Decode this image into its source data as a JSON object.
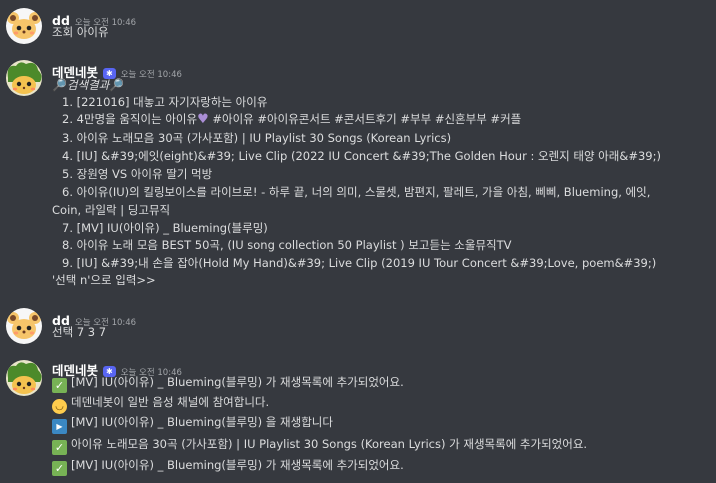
{
  "messages": [
    {
      "author": "dd",
      "timestamp": "오늘 오전 10:46",
      "is_bot": false,
      "lines": [
        "조회 아이유"
      ]
    },
    {
      "author": "데덴네봇",
      "timestamp": "오늘 오전 10:46",
      "is_bot": true,
      "bot_badge": "✱",
      "title_prefix": "🔎",
      "title": "검색결과",
      "title_suffix": "🔎",
      "results": [
        "1. [221016] 대놓고 자기자랑하는 아이유",
        "2. 4만명을 움직이는 아이유",
        "3. 아이유 노래모음 30곡 (가사포함) | IU Playlist 30 Songs (Korean Lyrics)",
        "4. [IU] &#39;에잇(eight)&#39; Live Clip (2022 IU Concert &#39;The Golden Hour : 오렌지 태양 아래&#39;)",
        "5. 장원영 VS 아이유 딸기 먹방",
        "6. 아이유(IU)의 킬링보이스를 라이브로! - 하루 끝, 너의 의미, 스물셋, 밤편지, 팔레트, 가을 아침, 삐삐, Blueming, 에잇,",
        "Coin, 라일락  |  딩고뮤직",
        "7. [MV] IU(아이유) _ Blueming(블루밍)",
        "8. 아이유 노래 모음 BEST 50곡, (IU song collection 50 Playlist ) 보고듣는 소울뮤직TV",
        "9. [IU] &#39;내 손을 잡아(Hold My Hand)&#39; Live Clip (2019 IU Tour Concert &#39;Love, poem&#39;)"
      ],
      "result2_suffix": " #아이유 #아이유콘서트 #콘서트후기 #부부 #신혼부부 #커플",
      "footer": "'선택 n'으로 입력>>"
    },
    {
      "author": "dd",
      "timestamp": "오늘 오전 10:46",
      "is_bot": false,
      "lines": [
        "선택 7 3 7"
      ]
    },
    {
      "author": "데덴네봇",
      "timestamp": "오늘 오전 10:46",
      "is_bot": true,
      "bot_badge": "✱",
      "lines": [
        "[MV] IU(아이유) _ Blueming(블루밍) 가 재생목록에 추가되었어요.",
        "데덴네봇이 일반 음성 채널에 참여합니다.",
        "[MV] IU(아이유) _ Blueming(블루밍) 을 재생합니다",
        "아이유 노래모음 30곡 (가사포함) | IU Playlist 30 Songs (Korean Lyrics) 가 재생목록에 추가되었어요.",
        "[MV] IU(아이유) _ Blueming(블루밍) 가 재생목록에 추가되었어요."
      ],
      "line_icons": [
        "check-icon",
        "smile-icon",
        "play-icon",
        "check-icon",
        "check-icon"
      ]
    }
  ],
  "colors": {
    "background": "#36393f",
    "text": "#dcddde",
    "username": "#ffffff",
    "timestamp": "#a3a6aa",
    "bot_badge": "#5865f2",
    "check": "#77b255",
    "play": "#3b88c3"
  }
}
